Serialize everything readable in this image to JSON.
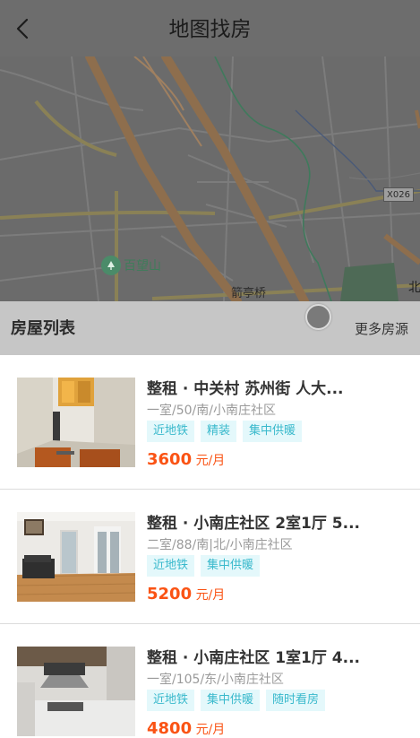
{
  "header": {
    "title": "地图找房",
    "back_icon": "chevron-left-icon"
  },
  "map": {
    "poi_name": "百望山",
    "poi_icon": "park-icon",
    "labels": {
      "bridge": "箭亭桥",
      "road_code": "X026",
      "edge_text": "北"
    }
  },
  "list_bar": {
    "title": "房屋列表",
    "more_label": "更多房源"
  },
  "houses": [
    {
      "title": "整租 · 中关村 苏州街 人大...",
      "desc": "一室/50/南/小南庄社区",
      "tags": [
        "近地铁",
        "精装",
        "集中供暖"
      ],
      "price": "3600",
      "unit": "元/月"
    },
    {
      "title": "整租 · 小南庄社区 2室1厅 5...",
      "desc": "二室/88/南|北/小南庄社区",
      "tags": [
        "近地铁",
        "集中供暖"
      ],
      "price": "5200",
      "unit": "元/月"
    },
    {
      "title": "整租 · 小南庄社区 1室1厅 4...",
      "desc": "一室/105/东/小南庄社区",
      "tags": [
        "近地铁",
        "集中供暖",
        "随时看房"
      ],
      "price": "4800",
      "unit": "元/月"
    }
  ]
}
